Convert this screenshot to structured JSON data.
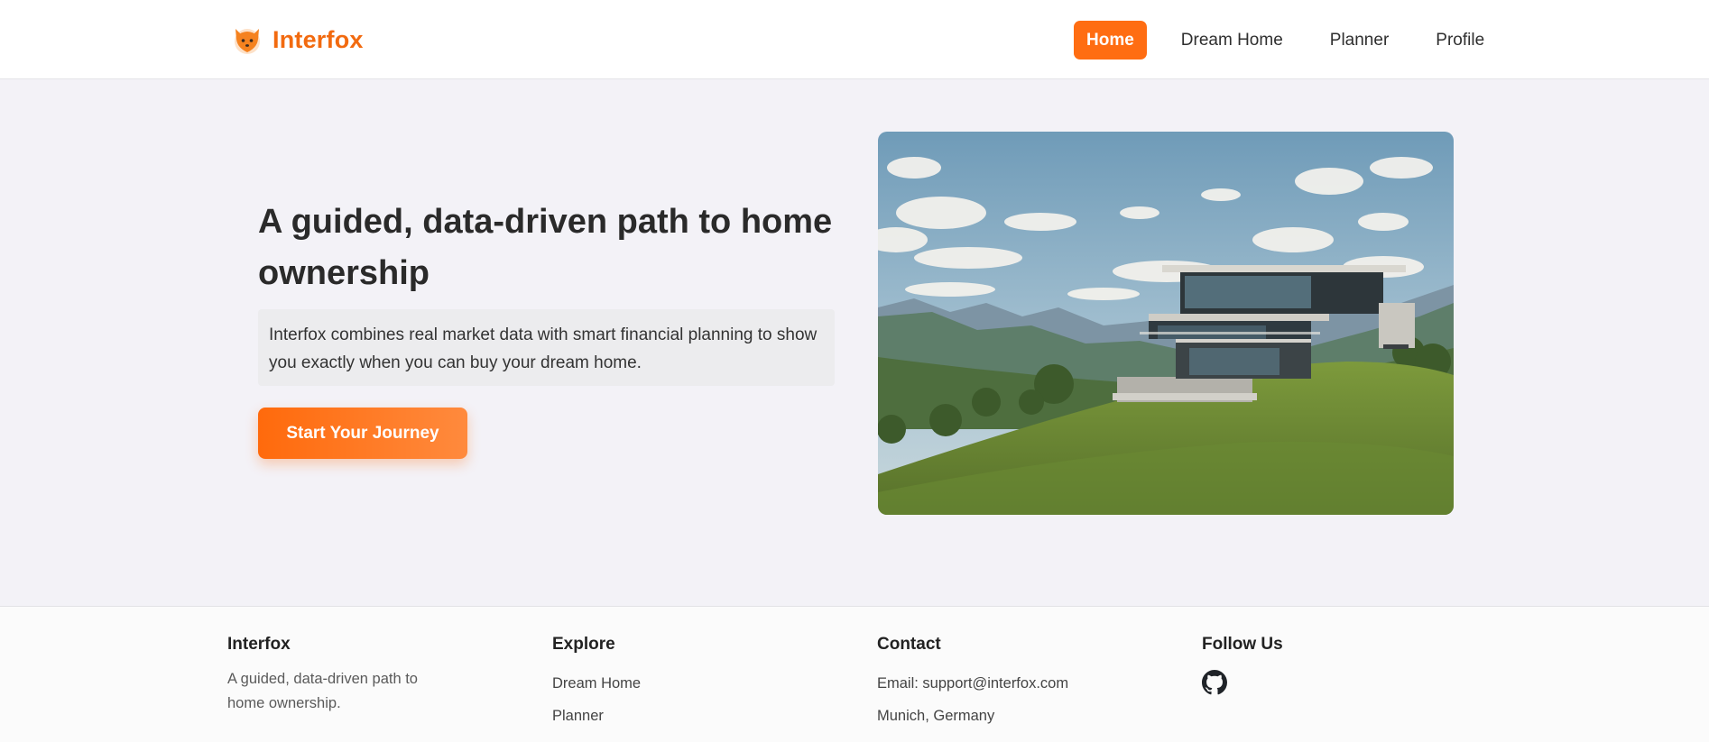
{
  "brand": {
    "name": "Interfox",
    "logo_icon": "fox-icon",
    "color": "#f26a0f"
  },
  "nav": {
    "items": [
      {
        "label": "Home",
        "active": true
      },
      {
        "label": "Dream Home",
        "active": false
      },
      {
        "label": "Planner",
        "active": false
      },
      {
        "label": "Profile",
        "active": false
      }
    ]
  },
  "hero": {
    "title": "A guided, data-driven path to home ownership",
    "description": "Interfox combines real market data with smart financial planning to show you exactly when you can buy your dream home.",
    "cta_label": "Start Your Journey",
    "image_alt": "Modern house on a green hillside"
  },
  "footer": {
    "brand": {
      "title": "Interfox",
      "tagline": "A guided, data-driven path to home ownership."
    },
    "explore": {
      "title": "Explore",
      "links": [
        "Dream Home",
        "Planner"
      ]
    },
    "contact": {
      "title": "Contact",
      "email_line": "Email: support@interfox.com",
      "location": "Munich, Germany"
    },
    "follow": {
      "title": "Follow Us",
      "icon": "github-icon"
    }
  },
  "colors": {
    "accent": "#ff6d12",
    "background": "#f3f2f7"
  }
}
